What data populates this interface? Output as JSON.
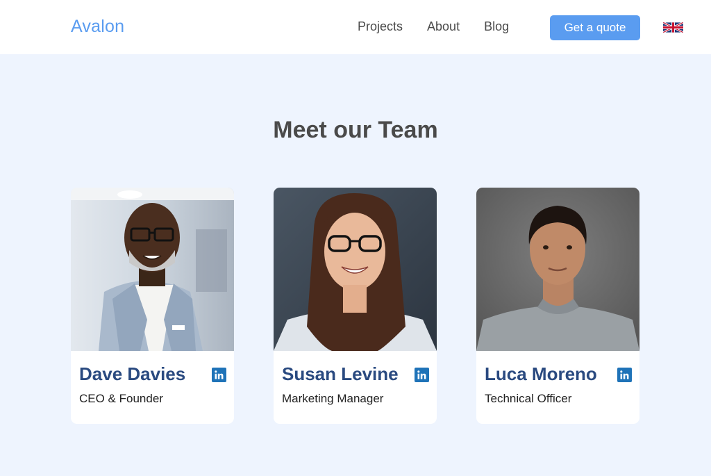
{
  "header": {
    "logo": "Avalon",
    "nav": [
      "Projects",
      "About",
      "Blog"
    ],
    "cta": "Get a quote",
    "language_icon": "uk-flag-icon"
  },
  "team": {
    "title": "Meet our Team",
    "members": [
      {
        "name": "Dave Davies",
        "role": "CEO & Founder",
        "social_icon": "linkedin-icon"
      },
      {
        "name": "Susan Levine",
        "role": "Marketing Manager",
        "social_icon": "linkedin-icon"
      },
      {
        "name": "Luca Moreno",
        "role": "Technical Officer",
        "social_icon": "linkedin-icon"
      }
    ]
  },
  "colors": {
    "brand": "#5a9cf0",
    "name": "#2a4a80",
    "linkedin": "#1f73b8",
    "background": "#eef4fe"
  }
}
